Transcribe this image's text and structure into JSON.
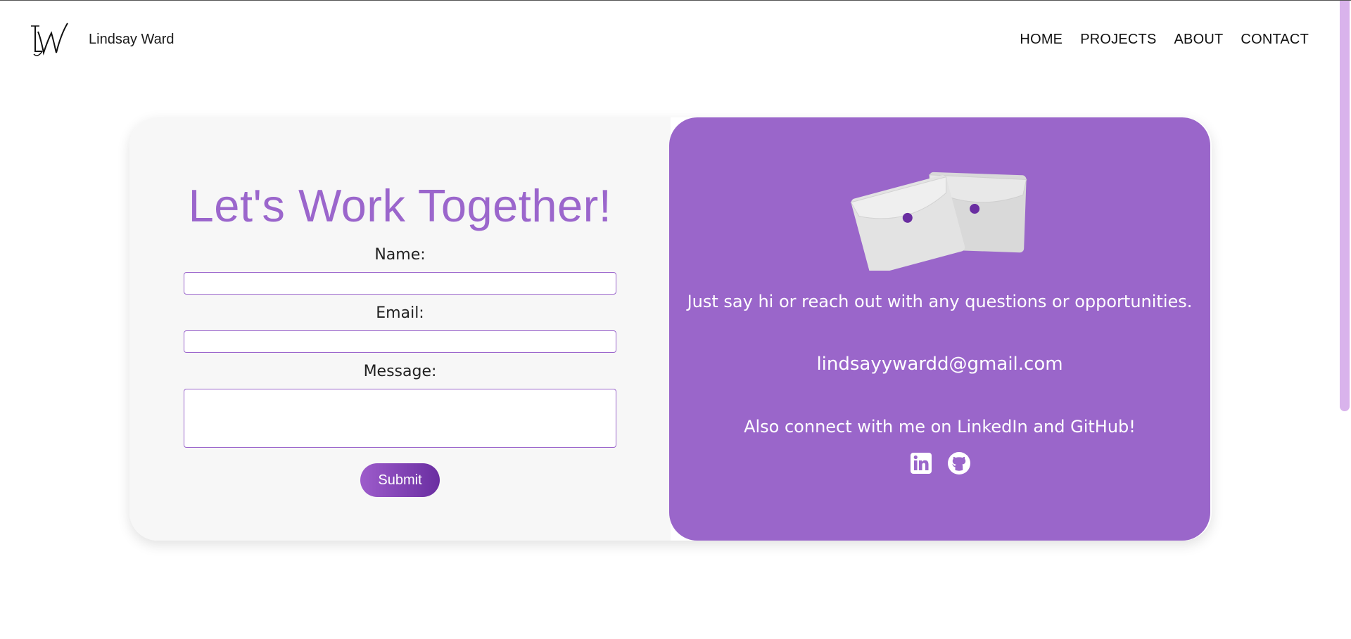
{
  "header": {
    "logo_text": "LW",
    "brand_name": "Lindsay Ward",
    "nav": [
      {
        "label": "HOME"
      },
      {
        "label": "PROJECTS"
      },
      {
        "label": "ABOUT"
      },
      {
        "label": "CONTACT"
      }
    ]
  },
  "form": {
    "title": "Let's Work Together!",
    "name_label": "Name:",
    "name_value": "",
    "email_label": "Email:",
    "email_value": "",
    "message_label": "Message:",
    "message_value": "",
    "submit_label": "Submit"
  },
  "info": {
    "intro": "Just say hi or reach out with any questions or opportunities.",
    "email": "lindsayywardd@gmail.com",
    "connect": "Also connect with me on LinkedIn and GitHub!",
    "social_icons": [
      "linkedin-icon",
      "github-icon"
    ]
  },
  "colors": {
    "accent": "#9b66cc",
    "panel_purple": "#9a66ca",
    "form_bg": "#f7f7f7",
    "button_gradient_start": "#9d5ccb",
    "button_gradient_end": "#6a2ea1",
    "scroll_thumb": "#d9b3ec"
  }
}
